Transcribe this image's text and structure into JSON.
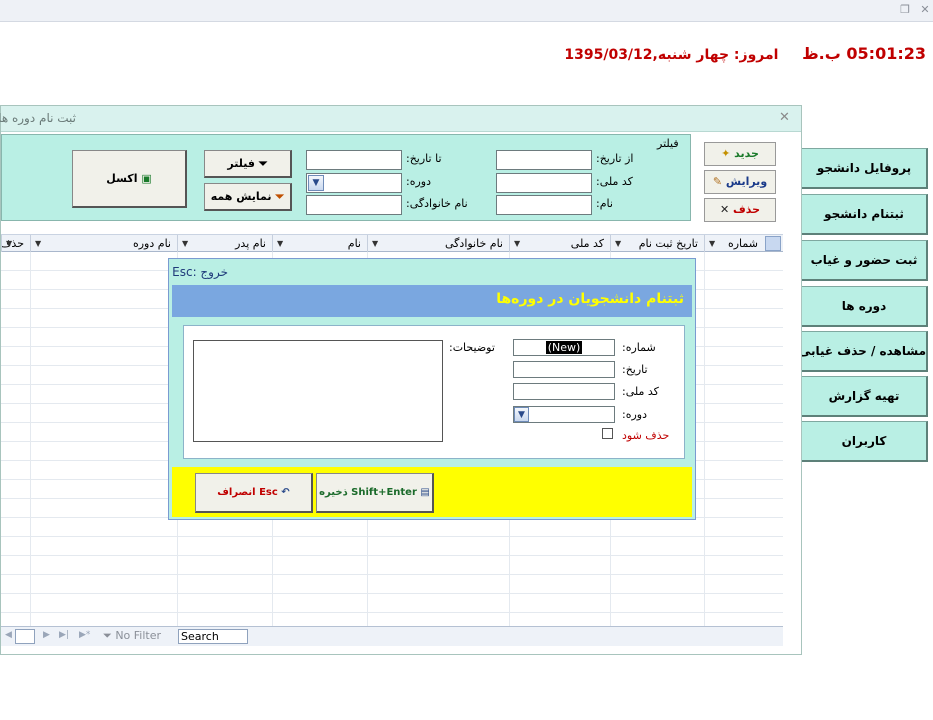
{
  "window": {
    "restore_icon": "restore-icon",
    "close_icon": "close-icon"
  },
  "clock": {
    "time": "05:01:23 ب.ظ",
    "date": "امروز: چهار شنبه,1395/03/12"
  },
  "nav": [
    "پروفایل دانشجو",
    "ثبتنام دانشجو",
    "ثبت حضور و غیاب",
    "دوره ها",
    "مشاهده / حذف غیابی",
    "تهیه گزارش",
    "کاربران"
  ],
  "form": {
    "title": "ثبت نام دوره ها -",
    "filter_legend": "فیلتر",
    "from_date_label": "از تاریخ:",
    "to_date_label": "تا تاریخ:",
    "national_code_label": "کد ملی:",
    "course_label": "دوره:",
    "name_label": "نام:",
    "family_label": "نام خانوادگی:",
    "filter_button": "فیلتر",
    "show_all_button": "نمایش همه",
    "excel_button": "اکسل",
    "new_button": "جدید",
    "edit_button": "ویرایش",
    "delete_button": "حذف"
  },
  "grid": {
    "columns": [
      "شماره",
      "تاریخ ثبت نام",
      "کد ملی",
      "نام خانوادگی",
      "نام",
      "نام پدر",
      "نام دوره",
      "حذف"
    ],
    "nav_filter": "No Filter",
    "search": "Search"
  },
  "dialog": {
    "exit": "خروج :Esc",
    "title": "ثبتنام دانشجویان در دوره‌ها",
    "number_label": "شماره:",
    "number_value": "(New)",
    "date_label": "تاریخ:",
    "national_code_label": "کد ملی:",
    "course_label": "دوره:",
    "delete_check_label": "حذف شود",
    "notes_label": "توضیحات:",
    "save_button": "ذخیره  Shift+Enter",
    "cancel_button": "انصراف  Esc"
  },
  "colors": {
    "accent_teal": "#b9efe4",
    "dialog_header": "#7aa7e0",
    "dialog_footer": "#ffff00",
    "clock_red": "#c00000"
  }
}
